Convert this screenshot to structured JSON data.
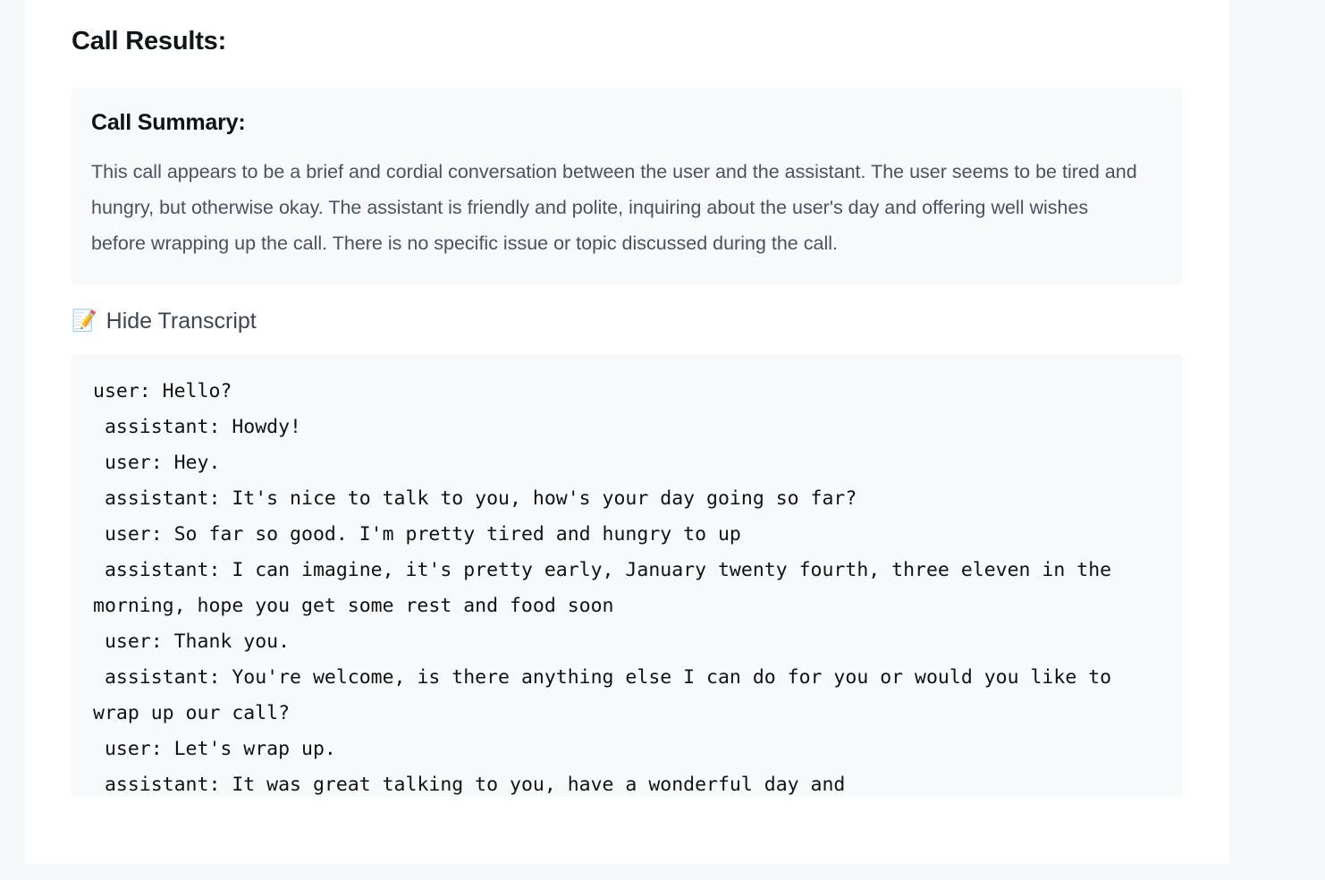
{
  "page": {
    "title": "Call Results:"
  },
  "summary": {
    "heading": "Call Summary:",
    "body": "This call appears to be a brief and cordial conversation between the user and the assistant. The user seems to be tired and hungry, but otherwise okay. The assistant is friendly and polite, inquiring about the user's day and offering well wishes before wrapping up the call. There is no specific issue or topic discussed during the call."
  },
  "transcript_toggle": {
    "icon": "📝",
    "icon_name": "memo-icon",
    "label": "Hide Transcript"
  },
  "transcript": {
    "text": "user: Hello?\n assistant: Howdy!\n user: Hey.\n assistant: It's nice to talk to you, how's your day going so far?\n user: So far so good. I'm pretty tired and hungry to up\n assistant: I can imagine, it's pretty early, January twenty fourth, three eleven in the morning, hope you get some rest and food soon\n user: Thank you.\n assistant: You're welcome, is there anything else I can do for you or would you like to wrap up our call?\n user: Let's wrap up.\n assistant: It was great talking to you, have a wonderful day and"
  },
  "colors": {
    "page_background": "#f7f8fa",
    "card_background": "#ffffff",
    "panel_background": "#f7f9fb",
    "heading_text": "#111418",
    "body_text": "#4a5260",
    "mono_text": "#121212"
  }
}
